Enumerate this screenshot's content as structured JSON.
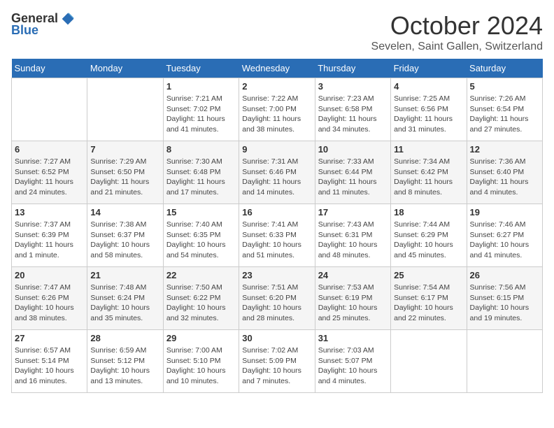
{
  "header": {
    "logo_general": "General",
    "logo_blue": "Blue",
    "month_title": "October 2024",
    "location": "Sevelen, Saint Gallen, Switzerland"
  },
  "days_of_week": [
    "Sunday",
    "Monday",
    "Tuesday",
    "Wednesday",
    "Thursday",
    "Friday",
    "Saturday"
  ],
  "weeks": [
    [
      {
        "day": "",
        "info": ""
      },
      {
        "day": "",
        "info": ""
      },
      {
        "day": "1",
        "info": "Sunrise: 7:21 AM\nSunset: 7:02 PM\nDaylight: 11 hours and 41 minutes."
      },
      {
        "day": "2",
        "info": "Sunrise: 7:22 AM\nSunset: 7:00 PM\nDaylight: 11 hours and 38 minutes."
      },
      {
        "day": "3",
        "info": "Sunrise: 7:23 AM\nSunset: 6:58 PM\nDaylight: 11 hours and 34 minutes."
      },
      {
        "day": "4",
        "info": "Sunrise: 7:25 AM\nSunset: 6:56 PM\nDaylight: 11 hours and 31 minutes."
      },
      {
        "day": "5",
        "info": "Sunrise: 7:26 AM\nSunset: 6:54 PM\nDaylight: 11 hours and 27 minutes."
      }
    ],
    [
      {
        "day": "6",
        "info": "Sunrise: 7:27 AM\nSunset: 6:52 PM\nDaylight: 11 hours and 24 minutes."
      },
      {
        "day": "7",
        "info": "Sunrise: 7:29 AM\nSunset: 6:50 PM\nDaylight: 11 hours and 21 minutes."
      },
      {
        "day": "8",
        "info": "Sunrise: 7:30 AM\nSunset: 6:48 PM\nDaylight: 11 hours and 17 minutes."
      },
      {
        "day": "9",
        "info": "Sunrise: 7:31 AM\nSunset: 6:46 PM\nDaylight: 11 hours and 14 minutes."
      },
      {
        "day": "10",
        "info": "Sunrise: 7:33 AM\nSunset: 6:44 PM\nDaylight: 11 hours and 11 minutes."
      },
      {
        "day": "11",
        "info": "Sunrise: 7:34 AM\nSunset: 6:42 PM\nDaylight: 11 hours and 8 minutes."
      },
      {
        "day": "12",
        "info": "Sunrise: 7:36 AM\nSunset: 6:40 PM\nDaylight: 11 hours and 4 minutes."
      }
    ],
    [
      {
        "day": "13",
        "info": "Sunrise: 7:37 AM\nSunset: 6:39 PM\nDaylight: 11 hours and 1 minute."
      },
      {
        "day": "14",
        "info": "Sunrise: 7:38 AM\nSunset: 6:37 PM\nDaylight: 10 hours and 58 minutes."
      },
      {
        "day": "15",
        "info": "Sunrise: 7:40 AM\nSunset: 6:35 PM\nDaylight: 10 hours and 54 minutes."
      },
      {
        "day": "16",
        "info": "Sunrise: 7:41 AM\nSunset: 6:33 PM\nDaylight: 10 hours and 51 minutes."
      },
      {
        "day": "17",
        "info": "Sunrise: 7:43 AM\nSunset: 6:31 PM\nDaylight: 10 hours and 48 minutes."
      },
      {
        "day": "18",
        "info": "Sunrise: 7:44 AM\nSunset: 6:29 PM\nDaylight: 10 hours and 45 minutes."
      },
      {
        "day": "19",
        "info": "Sunrise: 7:46 AM\nSunset: 6:27 PM\nDaylight: 10 hours and 41 minutes."
      }
    ],
    [
      {
        "day": "20",
        "info": "Sunrise: 7:47 AM\nSunset: 6:26 PM\nDaylight: 10 hours and 38 minutes."
      },
      {
        "day": "21",
        "info": "Sunrise: 7:48 AM\nSunset: 6:24 PM\nDaylight: 10 hours and 35 minutes."
      },
      {
        "day": "22",
        "info": "Sunrise: 7:50 AM\nSunset: 6:22 PM\nDaylight: 10 hours and 32 minutes."
      },
      {
        "day": "23",
        "info": "Sunrise: 7:51 AM\nSunset: 6:20 PM\nDaylight: 10 hours and 28 minutes."
      },
      {
        "day": "24",
        "info": "Sunrise: 7:53 AM\nSunset: 6:19 PM\nDaylight: 10 hours and 25 minutes."
      },
      {
        "day": "25",
        "info": "Sunrise: 7:54 AM\nSunset: 6:17 PM\nDaylight: 10 hours and 22 minutes."
      },
      {
        "day": "26",
        "info": "Sunrise: 7:56 AM\nSunset: 6:15 PM\nDaylight: 10 hours and 19 minutes."
      }
    ],
    [
      {
        "day": "27",
        "info": "Sunrise: 6:57 AM\nSunset: 5:14 PM\nDaylight: 10 hours and 16 minutes."
      },
      {
        "day": "28",
        "info": "Sunrise: 6:59 AM\nSunset: 5:12 PM\nDaylight: 10 hours and 13 minutes."
      },
      {
        "day": "29",
        "info": "Sunrise: 7:00 AM\nSunset: 5:10 PM\nDaylight: 10 hours and 10 minutes."
      },
      {
        "day": "30",
        "info": "Sunrise: 7:02 AM\nSunset: 5:09 PM\nDaylight: 10 hours and 7 minutes."
      },
      {
        "day": "31",
        "info": "Sunrise: 7:03 AM\nSunset: 5:07 PM\nDaylight: 10 hours and 4 minutes."
      },
      {
        "day": "",
        "info": ""
      },
      {
        "day": "",
        "info": ""
      }
    ]
  ]
}
